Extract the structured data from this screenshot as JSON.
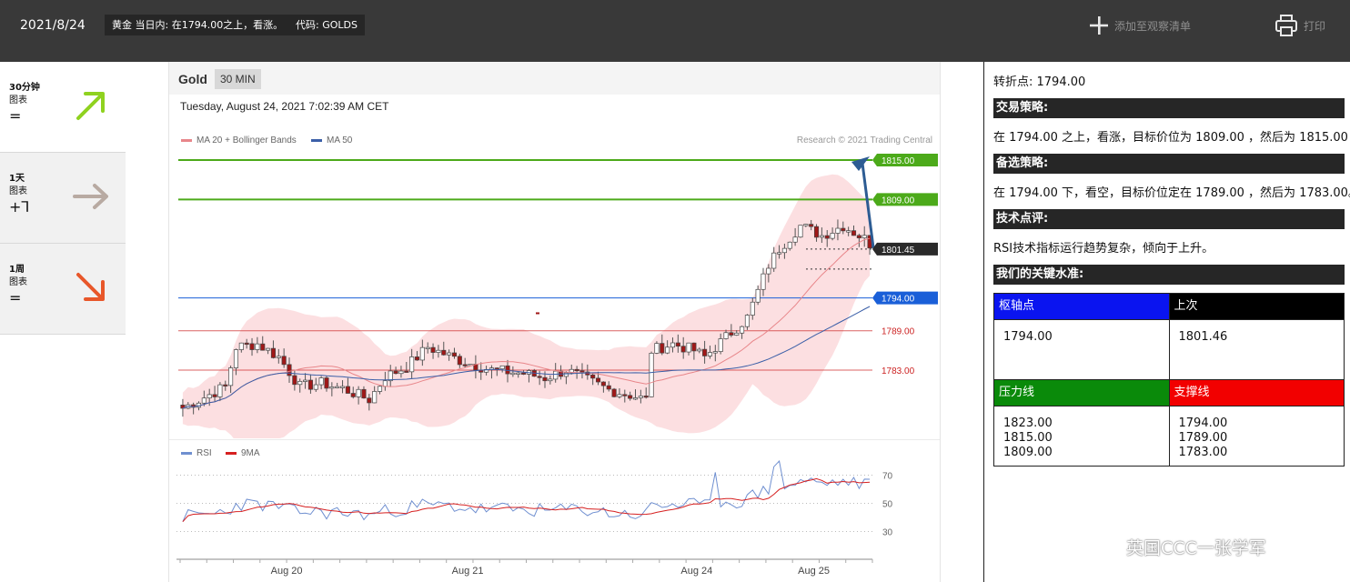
{
  "topbar": {
    "date": "2021/8/24",
    "summary": "黄金 当日内: 在1794.00之上，看涨。",
    "code": "代码: GOLDS",
    "watchlist_label": "添加至观察清单",
    "print_label": "打印"
  },
  "sidebar": {
    "items": [
      {
        "title": "30分钟",
        "sub": "图表",
        "symbol": "=",
        "direction": "up",
        "color": "#8fd21f"
      },
      {
        "title": "1天",
        "sub": "图表",
        "symbol": "+⅂",
        "direction": "right",
        "color": "#b8aaa2"
      },
      {
        "title": "1周",
        "sub": "图表",
        "symbol": "=",
        "direction": "down",
        "color": "#e8572a"
      }
    ]
  },
  "chart": {
    "symbol": "Gold",
    "timeframe": "30 MIN",
    "timestamp": "Tuesday, August 24, 2021 7:02:39 AM CET",
    "legend_ma20": "MA 20 + Bollinger Bands",
    "legend_ma50": "MA 50",
    "credit": "Research © 2021 Trading Central",
    "rsi_legend": "RSI",
    "ma9_legend": "9MA"
  },
  "chart_data": {
    "type": "candlestick",
    "x_ticks": [
      "Aug 20",
      "Aug 21",
      "Aug 24",
      "Aug 25"
    ],
    "price_levels": [
      {
        "label": "1815.00",
        "value": 1815.0,
        "kind": "target",
        "color": "#4caa1a"
      },
      {
        "label": "1809.00",
        "value": 1809.0,
        "kind": "target",
        "color": "#4caa1a"
      },
      {
        "label": "1801.45",
        "value": 1801.45,
        "kind": "last",
        "color": "#2a2a2a"
      },
      {
        "label": "1794.00",
        "value": 1794.0,
        "kind": "pivot",
        "color": "#1a5fd8"
      },
      {
        "label": "1789.00",
        "value": 1789.0,
        "kind": "support",
        "color": "#cc2222"
      },
      {
        "label": "1783.00",
        "value": 1783.0,
        "kind": "support",
        "color": "#cc2222"
      }
    ],
    "rsi_levels": [
      "70",
      "50",
      "30"
    ],
    "rsi_level_values": [
      70,
      50,
      30
    ],
    "colors": {
      "ma20": "#e8868a",
      "ma50": "#3b5fa8",
      "band": "#fbd9dc",
      "up_candle": "#ffffff",
      "down_candle": "#a01818",
      "rsi": "#6f8fd0",
      "ma9": "#d62020"
    }
  },
  "right": {
    "pivot_line": "转折点: 1794.00",
    "strategy_head": "交易策略:",
    "strategy_text": "在 1794.00 之上，看涨，目标价位为 1809.00 ，然后为 1815.00 。",
    "alt_head": "备选策略:",
    "alt_text": "在 1794.00 下，看空，目标价位定在 1789.00 ，然后为 1783.00。",
    "tech_head": "技术点评:",
    "tech_text": "RSI技术指标运行趋势复杂，倾向于上升。",
    "levels_head": "我们的关键水准:",
    "table": {
      "pivot_label": "枢轴点",
      "last_label": "上次",
      "pivot_value": "1794.00",
      "last_value": "1801.46",
      "res_label": "压力线",
      "sup_label": "支撑线",
      "resistance": [
        "1823.00",
        "1815.00",
        "1809.00"
      ],
      "support": [
        "1794.00",
        "1789.00",
        "1783.00"
      ]
    }
  },
  "watermark": "英国CCC一张学军"
}
